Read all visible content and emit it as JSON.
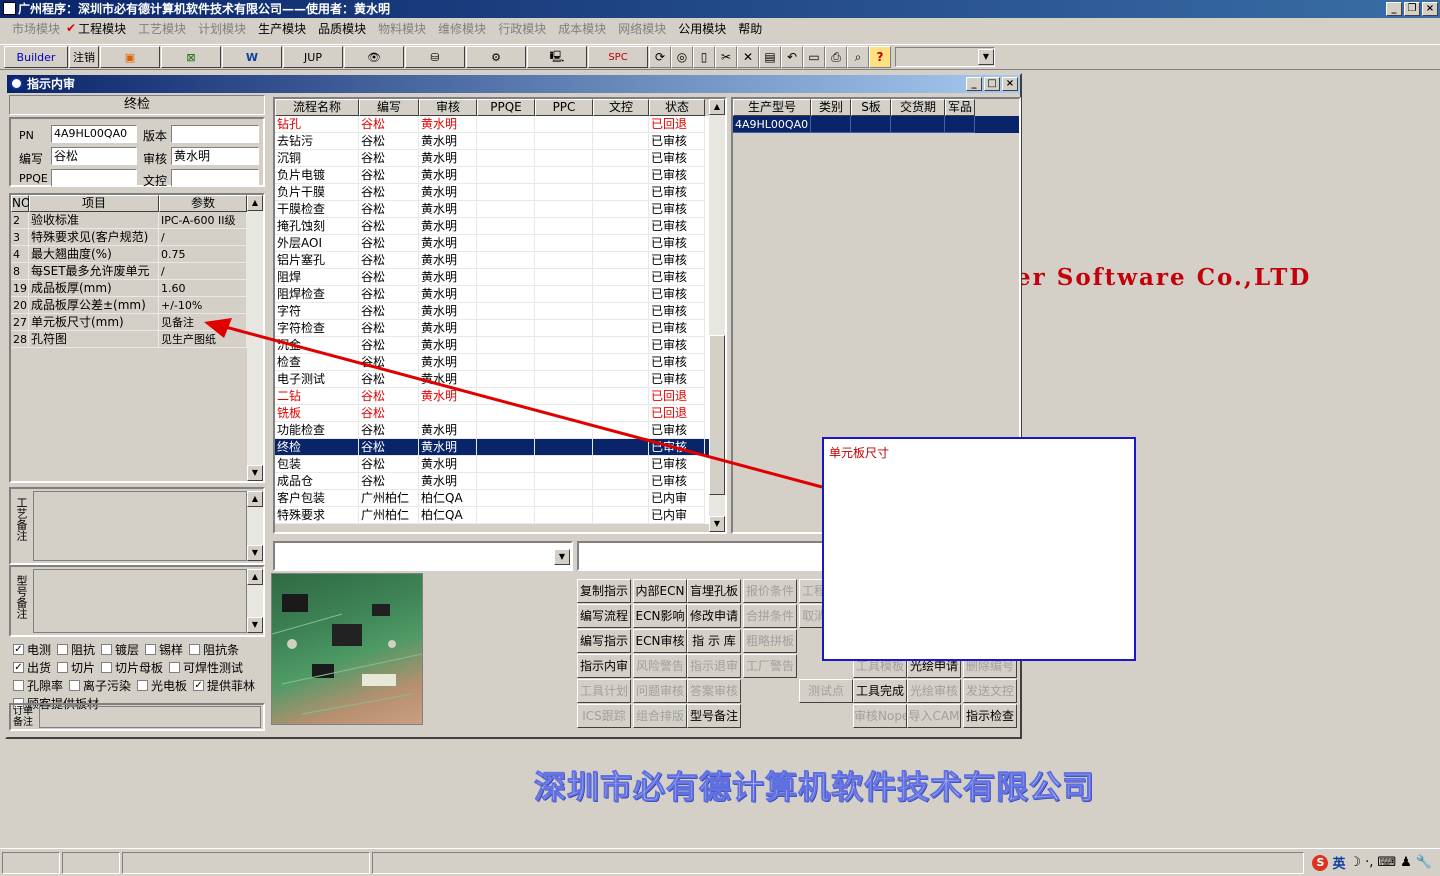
{
  "app": {
    "title": "广州程序：深圳市必有德计算机软件技术有限公司——使用者：黄水明"
  },
  "menu": [
    {
      "label": "市场模块",
      "enabled": false
    },
    {
      "label": "工程模块",
      "enabled": true
    },
    {
      "label": "工艺模块",
      "enabled": false
    },
    {
      "label": "计划模块",
      "enabled": false
    },
    {
      "label": "生产模块",
      "enabled": true
    },
    {
      "label": "品质模块",
      "enabled": true
    },
    {
      "label": "物料模块",
      "enabled": false
    },
    {
      "label": "维修模块",
      "enabled": false
    },
    {
      "label": "行政模块",
      "enabled": false
    },
    {
      "label": "成本模块",
      "enabled": false
    },
    {
      "label": "网络模块",
      "enabled": false
    },
    {
      "label": "公用模块",
      "enabled": true
    },
    {
      "label": "帮助",
      "enabled": true
    }
  ],
  "toolbar": {
    "builder": "Builder",
    "logout": "注销",
    "jup": "JUP",
    "spc": "SPC"
  },
  "background": {
    "english": "er Software Co.,LTD",
    "company": "深圳市必有德计算机软件技术有限公司"
  },
  "window": {
    "title": "指示内审"
  },
  "left": {
    "header": "终检",
    "pn_label": "PN",
    "pn_value": "4A9HL00QA0",
    "version_label": "版本",
    "version_value": "",
    "author_label": "编写",
    "author_value": "谷松",
    "review_label": "审核",
    "review_value": "黄水明",
    "ppqe_label": "PPQE",
    "ppqe_value": "",
    "doc_label": "文控",
    "doc_value": "",
    "param_headers": [
      "NO",
      "项目",
      "参数"
    ],
    "params": [
      {
        "no": "2",
        "item": "验收标准",
        "value": "IPC-A-600 II级"
      },
      {
        "no": "3",
        "item": "特殊要求见(客户规范)",
        "value": "/"
      },
      {
        "no": "4",
        "item": "最大翘曲度(%)",
        "value": "0.75"
      },
      {
        "no": "8",
        "item": "每SET最多允许废单元",
        "value": "/"
      },
      {
        "no": "19",
        "item": "成品板厚(mm)",
        "value": "1.60"
      },
      {
        "no": "20",
        "item": "成品板厚公差±(mm)",
        "value": "+/-10%"
      },
      {
        "no": "27",
        "item": "单元板尺寸(mm)",
        "value": "见备注"
      },
      {
        "no": "28",
        "item": "孔符图",
        "value": "见生产图纸"
      }
    ],
    "process_note_label": "工艺备注",
    "model_note_label": "型号备注",
    "order_note_label": "订单备注",
    "checks": [
      {
        "label": "电测",
        "checked": true
      },
      {
        "label": "阻抗",
        "checked": false
      },
      {
        "label": "镀层",
        "checked": false
      },
      {
        "label": "锡样",
        "checked": false
      },
      {
        "label": "阻抗条",
        "checked": false
      },
      {
        "label": "出货",
        "checked": true
      },
      {
        "label": "切片",
        "checked": false
      },
      {
        "label": "切片母板",
        "checked": false
      },
      {
        "label": "可焊性测试",
        "checked": false
      },
      {
        "label": "孔隙率",
        "checked": false
      },
      {
        "label": "离子污染",
        "checked": false
      },
      {
        "label": "光电板",
        "checked": false
      },
      {
        "label": "提供菲林",
        "checked": true
      },
      {
        "label": "顾客提供板材",
        "checked": false
      }
    ]
  },
  "flow": {
    "headers": [
      "流程名称",
      "编写",
      "审核",
      "PPQE",
      "PPC",
      "文控",
      "状态"
    ],
    "rows": [
      {
        "name": "钻孔",
        "author": "谷松",
        "reviewer": "黄水明",
        "status": "已回退",
        "red": true
      },
      {
        "name": "去钻污",
        "author": "谷松",
        "reviewer": "黄水明",
        "status": "已审核",
        "red": false
      },
      {
        "name": "沉铜",
        "author": "谷松",
        "reviewer": "黄水明",
        "status": "已审核",
        "red": false
      },
      {
        "name": "负片电镀",
        "author": "谷松",
        "reviewer": "黄水明",
        "status": "已审核",
        "red": false
      },
      {
        "name": "负片干膜",
        "author": "谷松",
        "reviewer": "黄水明",
        "status": "已审核",
        "red": false
      },
      {
        "name": "干膜检查",
        "author": "谷松",
        "reviewer": "黄水明",
        "status": "已审核",
        "red": false
      },
      {
        "name": "掩孔蚀刻",
        "author": "谷松",
        "reviewer": "黄水明",
        "status": "已审核",
        "red": false
      },
      {
        "name": "外层AOI",
        "author": "谷松",
        "reviewer": "黄水明",
        "status": "已审核",
        "red": false
      },
      {
        "name": "铝片塞孔",
        "author": "谷松",
        "reviewer": "黄水明",
        "status": "已审核",
        "red": false
      },
      {
        "name": "阻焊",
        "author": "谷松",
        "reviewer": "黄水明",
        "status": "已审核",
        "red": false
      },
      {
        "name": "阻焊检查",
        "author": "谷松",
        "reviewer": "黄水明",
        "status": "已审核",
        "red": false
      },
      {
        "name": "字符",
        "author": "谷松",
        "reviewer": "黄水明",
        "status": "已审核",
        "red": false
      },
      {
        "name": "字符检查",
        "author": "谷松",
        "reviewer": "黄水明",
        "status": "已审核",
        "red": false
      },
      {
        "name": "沉金",
        "author": "谷松",
        "reviewer": "黄水明",
        "status": "已审核",
        "red": false
      },
      {
        "name": "检查",
        "author": "谷松",
        "reviewer": "黄水明",
        "status": "已审核",
        "red": false
      },
      {
        "name": "电子测试",
        "author": "谷松",
        "reviewer": "黄水明",
        "status": "已审核",
        "red": false
      },
      {
        "name": "二钻",
        "author": "谷松",
        "reviewer": "黄水明",
        "status": "已回退",
        "red": true
      },
      {
        "name": "铣板",
        "author": "谷松",
        "reviewer": "",
        "status": "已回退",
        "red": true
      },
      {
        "name": "功能检查",
        "author": "谷松",
        "reviewer": "黄水明",
        "status": "已审核",
        "red": false
      },
      {
        "name": "终检",
        "author": "谷松",
        "reviewer": "黄水明",
        "status": "已审核",
        "red": false
      },
      {
        "name": "包装",
        "author": "谷松",
        "reviewer": "黄水明",
        "status": "已审核",
        "red": false
      },
      {
        "name": "成品仓",
        "author": "谷松",
        "reviewer": "黄水明",
        "status": "已审核",
        "red": false
      },
      {
        "name": "客户包装",
        "author": "广州柏仁",
        "reviewer": "柏仁QA",
        "status": "已内审",
        "red": false
      },
      {
        "name": "特殊要求",
        "author": "广州柏仁",
        "reviewer": "柏仁QA",
        "status": "已内审",
        "red": false
      }
    ],
    "selected_index": 19
  },
  "model": {
    "headers": [
      "生产型号",
      "类别",
      "S板",
      "交货期",
      "军品"
    ],
    "rows": [
      {
        "model": "4A9HL00QA0",
        "type": "",
        "s": "",
        "date": "",
        "mil": ""
      }
    ]
  },
  "buttons": [
    {
      "label": "复制指示",
      "enabled": true
    },
    {
      "label": "内部ECN",
      "enabled": true
    },
    {
      "label": "盲埋孔板",
      "enabled": true
    },
    {
      "label": "报价条件",
      "enabled": false
    },
    {
      "label": "工程",
      "enabled": false
    },
    {
      "label": "编写流程",
      "enabled": true
    },
    {
      "label": "ECN影响",
      "enabled": true
    },
    {
      "label": "修改申请",
      "enabled": true
    },
    {
      "label": "合拼条件",
      "enabled": false
    },
    {
      "label": "取消",
      "enabled": false
    },
    {
      "label": "编写指示",
      "enabled": true
    },
    {
      "label": "ECN审核",
      "enabled": true
    },
    {
      "label": "指 示 库",
      "enabled": true
    },
    {
      "label": "粗略拼板",
      "enabled": false
    },
    {
      "label": "指示内审",
      "enabled": true
    },
    {
      "label": "风险警告",
      "enabled": false
    },
    {
      "label": "指示退审",
      "enabled": false
    },
    {
      "label": "工厂警告",
      "enabled": false
    },
    {
      "label": "工具模板",
      "enabled": false
    },
    {
      "label": "光绘申请",
      "enabled": true
    },
    {
      "label": "删除编号",
      "enabled": false
    },
    {
      "label": "工具计划",
      "enabled": false
    },
    {
      "label": "问题审核",
      "enabled": false
    },
    {
      "label": "答案审核",
      "enabled": false
    },
    {
      "label": "测试点",
      "enabled": false
    },
    {
      "label": "工具完成",
      "enabled": true
    },
    {
      "label": "光绘审核",
      "enabled": false
    },
    {
      "label": "发送文控",
      "enabled": false
    },
    {
      "label": "ICS跟踪",
      "enabled": false
    },
    {
      "label": "组合排版",
      "enabled": false
    },
    {
      "label": "型号备注",
      "enabled": true
    },
    {
      "label": "审核Nope",
      "enabled": false
    },
    {
      "label": "导入CAM",
      "enabled": false
    },
    {
      "label": "指示检查",
      "enabled": true
    }
  ],
  "popup": {
    "title": "单元板尺寸"
  },
  "tray": {
    "ime": "英"
  },
  "colors": {
    "arrow": "#e00000",
    "selection": "#0a246a",
    "popup_border": "#1818c8"
  }
}
